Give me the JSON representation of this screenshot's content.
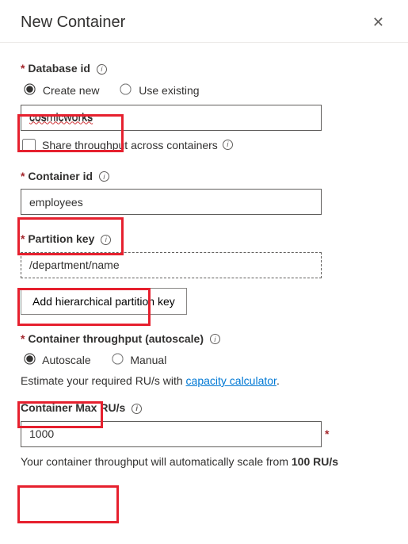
{
  "header": {
    "title": "New Container",
    "close_glyph": "✕"
  },
  "databaseId": {
    "label": "Database id",
    "createNew": "Create new",
    "useExisting": "Use existing",
    "value": "cosmicworks",
    "shareThroughput": "Share throughput across containers"
  },
  "containerId": {
    "label": "Container id",
    "value": "employees"
  },
  "partitionKey": {
    "label": "Partition key",
    "value": "/department/name",
    "addHierarchical": "Add hierarchical partition key"
  },
  "throughput": {
    "label": "Container throughput (autoscale)",
    "autoscale": "Autoscale",
    "manual": "Manual",
    "estimatePrefix": "Estimate your required RU/s with ",
    "calculatorLink": "capacity calculator",
    "estimateSuffix": ".",
    "maxLabel": "Container Max RU/s",
    "maxValue": "1000",
    "footerPrefix": "Your container throughput will automatically scale from ",
    "footerStrong": "100 RU/s"
  }
}
